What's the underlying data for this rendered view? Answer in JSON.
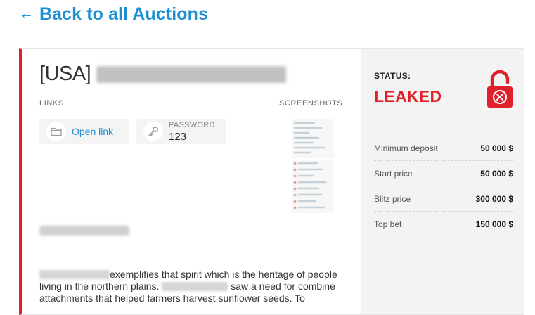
{
  "nav": {
    "back_arrow": "←",
    "back_label": "Back to all Auctions"
  },
  "auction": {
    "country_prefix": "[USA]",
    "links_label": "LINKS",
    "screenshots_label": "SCREENSHOTS",
    "open_link_label": "Open link",
    "password_label": "PASSWORD",
    "password_value": "123",
    "description_line1": "exemplifies that spirit which is the heritage of people",
    "description_line2_start": "living in the northern plains.",
    "description_line2_end": "saw a need for combine",
    "description_line3": "attachments that helped farmers harvest sunflower seeds. To"
  },
  "status": {
    "label": "STATUS:",
    "value": "LEAKED"
  },
  "stats": [
    {
      "name": "Minimum deposit",
      "value": "50 000 $"
    },
    {
      "name": "Start price",
      "value": "50 000 $"
    },
    {
      "name": "Blitz price",
      "value": "300 000 $"
    },
    {
      "name": "Top bet",
      "value": "150 000 $"
    }
  ],
  "colors": {
    "accent": "#1f8fd1",
    "leak_red": "#e0202b",
    "panel_bg": "#f3f3f3"
  },
  "icons": {
    "back": "arrow-left-icon",
    "folder": "folder-icon",
    "key": "key-icon",
    "lock": "unlocked-padlock-icon"
  }
}
